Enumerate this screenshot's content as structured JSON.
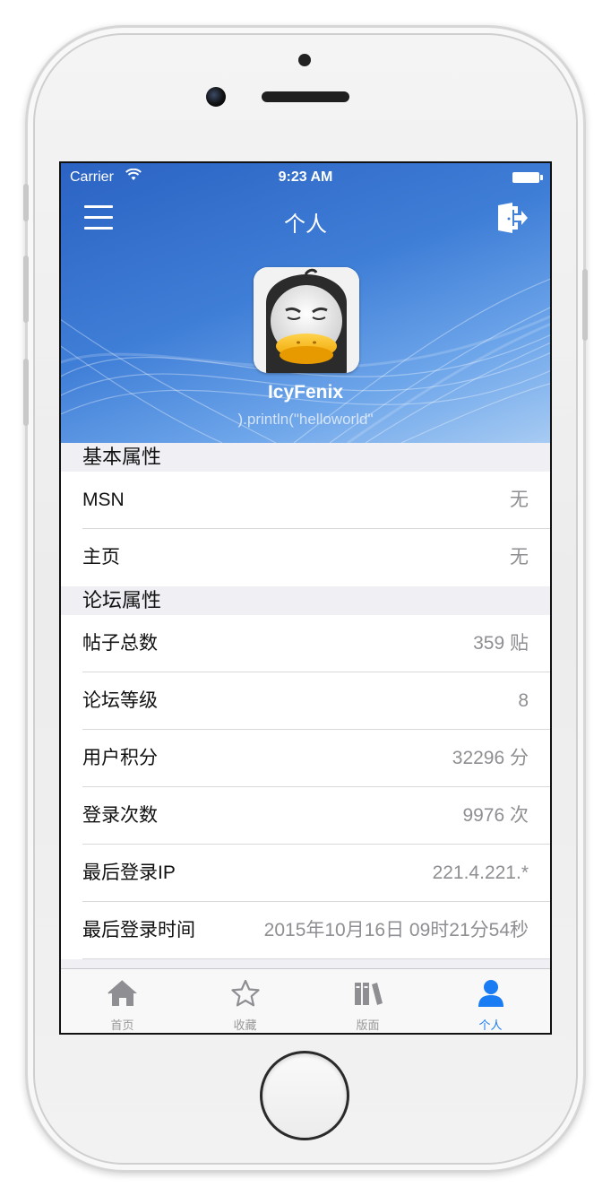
{
  "status_bar": {
    "carrier": "Carrier",
    "time": "9:23 AM"
  },
  "nav": {
    "title": "个人"
  },
  "profile": {
    "username": "IcyFenix",
    "signature": ").println(\"helloworld\""
  },
  "sections": [
    {
      "title": "基本属性",
      "rows": [
        {
          "label": "MSN",
          "value": "无"
        },
        {
          "label": "主页",
          "value": "无"
        }
      ]
    },
    {
      "title": "论坛属性",
      "rows": [
        {
          "label": "帖子总数",
          "value": "359 贴"
        },
        {
          "label": "论坛等级",
          "value": "8"
        },
        {
          "label": "用户积分",
          "value": "32296 分"
        },
        {
          "label": "登录次数",
          "value": "9976 次"
        },
        {
          "label": "最后登录IP",
          "value": "221.4.221.*"
        },
        {
          "label": "最后登录时间",
          "value": "2015年10月16日 09时21分54秒"
        }
      ]
    }
  ],
  "tabbar": {
    "tabs": [
      {
        "label": "首页",
        "icon": "home-icon",
        "active": false
      },
      {
        "label": "收藏",
        "icon": "star-icon",
        "active": false
      },
      {
        "label": "版面",
        "icon": "books-icon",
        "active": false
      },
      {
        "label": "个人",
        "icon": "person-icon",
        "active": true
      }
    ],
    "active_color": "#1a7cf2",
    "inactive_color": "#999999"
  },
  "colors": {
    "header_blue": "#3f7ed7",
    "background": "#efeff4"
  }
}
